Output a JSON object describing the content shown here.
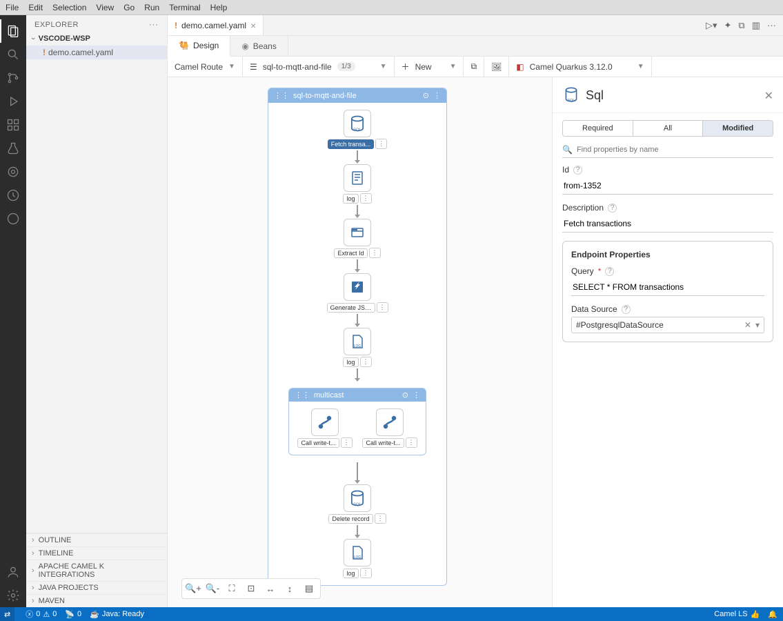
{
  "menu": [
    "File",
    "Edit",
    "Selection",
    "View",
    "Go",
    "Run",
    "Terminal",
    "Help"
  ],
  "explorer": {
    "title": "EXPLORER",
    "folder": "VSCODE-WSP",
    "file": "demo.camel.yaml",
    "sections": [
      "OUTLINE",
      "TIMELINE",
      "APACHE CAMEL K INTEGRATIONS",
      "JAVA PROJECTS",
      "MAVEN"
    ]
  },
  "tab": {
    "name": "demo.camel.yaml"
  },
  "designTabs": {
    "design": "Design",
    "beans": "Beans"
  },
  "toolbar": {
    "route": "Camel Route",
    "routeName": "sql-to-mqtt-and-file",
    "routeCount": "1/3",
    "newLabel": "New",
    "runtime": "Camel Quarkus 3.12.0"
  },
  "route": {
    "title": "sql-to-mqtt-and-file",
    "nodes": {
      "sql1": "Fetch transa...",
      "log1": "log",
      "extract": "Extract Id",
      "genjson": "Generate JSON",
      "log2": "log",
      "multicast": "multicast",
      "call1": "Call write-t...",
      "call2": "Call write-t...",
      "sql2": "Delete record",
      "log3": "log"
    }
  },
  "props": {
    "title": "Sql",
    "tabs": {
      "required": "Required",
      "all": "All",
      "modified": "Modified"
    },
    "searchPlaceholder": "Find properties by name",
    "idLabel": "Id",
    "idValue": "from-1352",
    "descLabel": "Description",
    "descValue": "Fetch transactions",
    "endpointTitle": "Endpoint Properties",
    "queryLabel": "Query",
    "queryValue": "SELECT * FROM transactions",
    "dsLabel": "Data Source",
    "dsValue": "#PostgresqlDataSource"
  },
  "status": {
    "errors": "0",
    "warnings": "0",
    "ports": "0",
    "java": "Java: Ready",
    "camells": "Camel LS"
  }
}
